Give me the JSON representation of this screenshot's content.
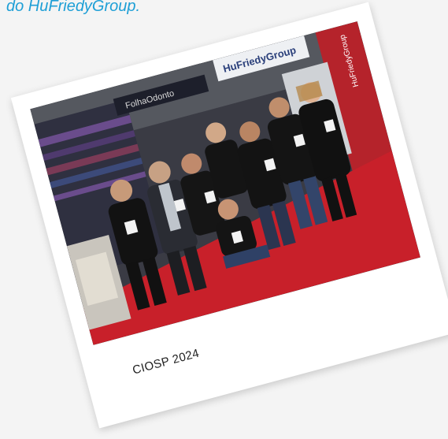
{
  "headline": "do HuFriedyGroup.",
  "photo": {
    "banner_text": "HuFriedyGroup",
    "side_banner_text": "HuFriedyGroup",
    "booth_text": "FolhaOdonto"
  },
  "caption": "CIOSP 2024",
  "colors": {
    "headline": "#1e9fd6",
    "carpet": "#c8202a",
    "side_banner": "#b5232b",
    "shirts": "#121212"
  }
}
